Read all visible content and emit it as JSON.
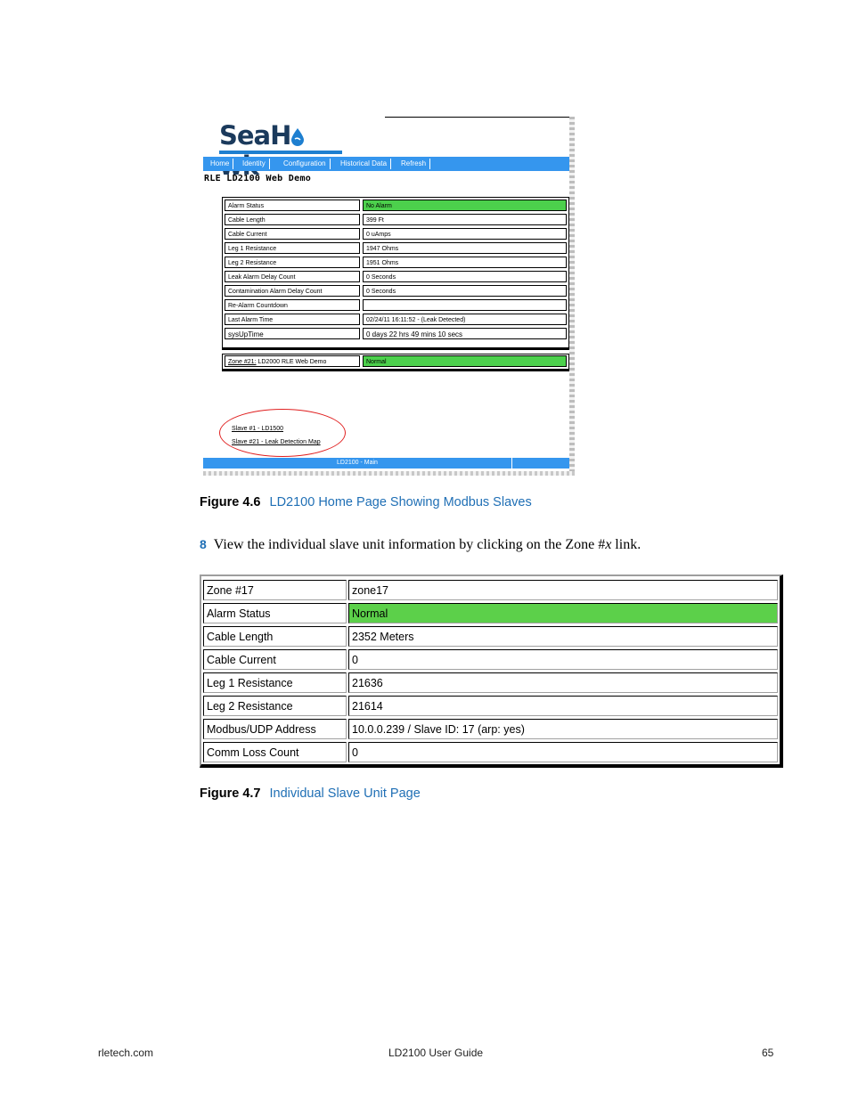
{
  "figure46": {
    "logo": "SeaHawk",
    "nav": [
      "Home",
      "Identity",
      "Configuration",
      "Historical Data",
      "Refresh"
    ],
    "demo_title": "RLE LD2100 Web Demo",
    "status_rows": [
      {
        "label": "Alarm Status",
        "value": "No Alarm"
      },
      {
        "label": "Cable Length",
        "value": "399 Ft"
      },
      {
        "label": "Cable Current",
        "value": "0 uAmps"
      },
      {
        "label": "Leg 1 Resistance",
        "value": "1947 Ohms"
      },
      {
        "label": "Leg 2 Resistance",
        "value": "1951 Ohms"
      },
      {
        "label": "Leak Alarm Delay Count",
        "value": "0 Seconds"
      },
      {
        "label": "Contamination Alarm Delay Count",
        "value": "0 Seconds"
      },
      {
        "label": "Re-Alarm Countdown",
        "value": ""
      },
      {
        "label": "Last Alarm Time",
        "value": "02/24/11 16:11:52  -  (Leak Detected)"
      },
      {
        "label": "sysUpTime",
        "value": "0 days 22 hrs 49 mins 10 secs"
      }
    ],
    "zone_link": "Zone #21:",
    "zone_name": " LD2000 RLE Web Demo",
    "zone_status": "Normal",
    "slave_links": [
      "Slave #1 - LD1500",
      "Slave #21 - Leak Detection Map"
    ],
    "footer": "LD2100 - Main"
  },
  "caption46": {
    "number": "Figure 4.6",
    "text": "LD2100 Home Page Showing Modbus Slaves"
  },
  "step": {
    "number": "8",
    "text_before": "View the individual slave unit information by clicking on the Zone #",
    "italic": "x",
    "text_after": " link."
  },
  "figure47": {
    "rows": [
      {
        "label": "Zone #17",
        "value": "zone17"
      },
      {
        "label": "Alarm Status",
        "value": "Normal"
      },
      {
        "label": "Cable Length",
        "value": "2352 Meters"
      },
      {
        "label": "Cable Current",
        "value": "0"
      },
      {
        "label": "Leg 1 Resistance",
        "value": "21636"
      },
      {
        "label": "Leg 2 Resistance",
        "value": "21614"
      },
      {
        "label": "Modbus/UDP Address",
        "value": "10.0.0.239 / Slave ID: 17 (arp: yes)"
      },
      {
        "label": "Comm Loss Count",
        "value": "0"
      }
    ]
  },
  "caption47": {
    "number": "Figure 4.7",
    "text": "Individual Slave Unit Page"
  },
  "page_footer": {
    "left": "rletech.com",
    "center": "LD2100 User Guide",
    "right": "65"
  },
  "colors": {
    "nav_blue": "#3596ee",
    "alarm_green": "#4cd04c",
    "caption_blue": "#1f6fb5",
    "highlight_circle": "#e02020"
  }
}
